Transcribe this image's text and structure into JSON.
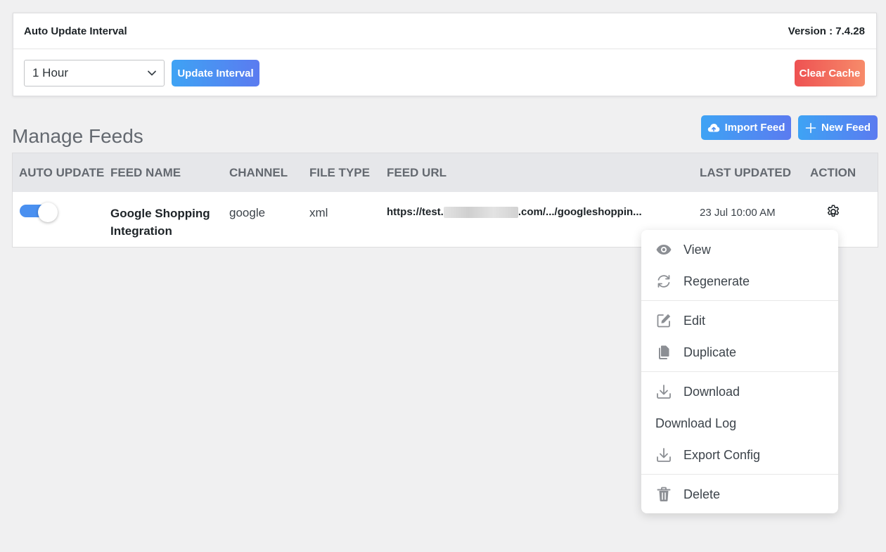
{
  "settings": {
    "title": "Auto Update Interval",
    "version": "Version : 7.4.28",
    "interval_selected": "1 Hour",
    "update_button": "Update Interval",
    "clear_button": "Clear Cache"
  },
  "manage": {
    "title": "Manage Feeds",
    "import_button": "Import Feed",
    "new_button": "New Feed"
  },
  "table": {
    "headers": [
      "AUTO UPDATE",
      "FEED NAME",
      "CHANNEL",
      "FILE TYPE",
      "FEED URL",
      "LAST UPDATED",
      "ACTION"
    ],
    "rows": [
      {
        "auto_update": true,
        "feed_name": "Google Shopping Integration",
        "channel": "google",
        "file_type": "xml",
        "feed_url_prefix": "https://test.",
        "feed_url_suffix": ".com/.../googleshoppin...",
        "last_updated": "23 Jul 10:00 AM"
      }
    ]
  },
  "menu": {
    "items": [
      {
        "label": "View",
        "icon": "eye-icon"
      },
      {
        "label": "Regenerate",
        "icon": "refresh-icon"
      },
      {
        "label": "Edit",
        "icon": "edit-icon"
      },
      {
        "label": "Duplicate",
        "icon": "copy-icon"
      },
      {
        "label": "Download",
        "icon": "download-icon"
      },
      {
        "label": "Download Log",
        "icon": ""
      },
      {
        "label": "Export Config",
        "icon": "download-icon"
      },
      {
        "label": "Delete",
        "icon": "trash-icon"
      }
    ]
  },
  "colors": {
    "accent_gradient_start": "#3ea3f4",
    "accent_gradient_end": "#5b7bf0",
    "danger_gradient_start": "#ee5252",
    "danger_gradient_end": "#f78b6a",
    "toggle_on": "#4a90f0"
  }
}
